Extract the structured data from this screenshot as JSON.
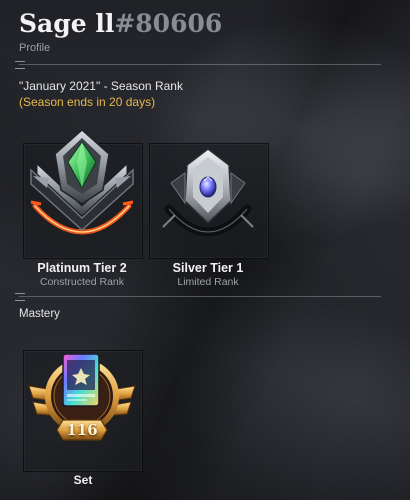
{
  "header": {
    "player_name": "Sage ll",
    "player_tag": "#80606",
    "subtitle": "Profile"
  },
  "season": {
    "title": "\"January 2021\" - Season Rank",
    "note": "(Season ends in 20 days)"
  },
  "ranks": [
    {
      "tier": "Platinum Tier 2",
      "format": "Constructed Rank",
      "icon": "platinum-rank-icon"
    },
    {
      "tier": "Silver Tier 1",
      "format": "Limited Rank",
      "icon": "silver-rank-icon"
    }
  ],
  "mastery": {
    "section_label": "Mastery",
    "level": "116",
    "label": "Set",
    "icon": "card-mastery-icon"
  },
  "colors": {
    "season_note": "#e8b949",
    "player_tag": "#8a8c91",
    "platinum_gem": "#3fbf5a",
    "platinum_glow": "#ff5a1a",
    "silver_gem": "#7a7cff",
    "mastery_gold": "#e0a040"
  }
}
